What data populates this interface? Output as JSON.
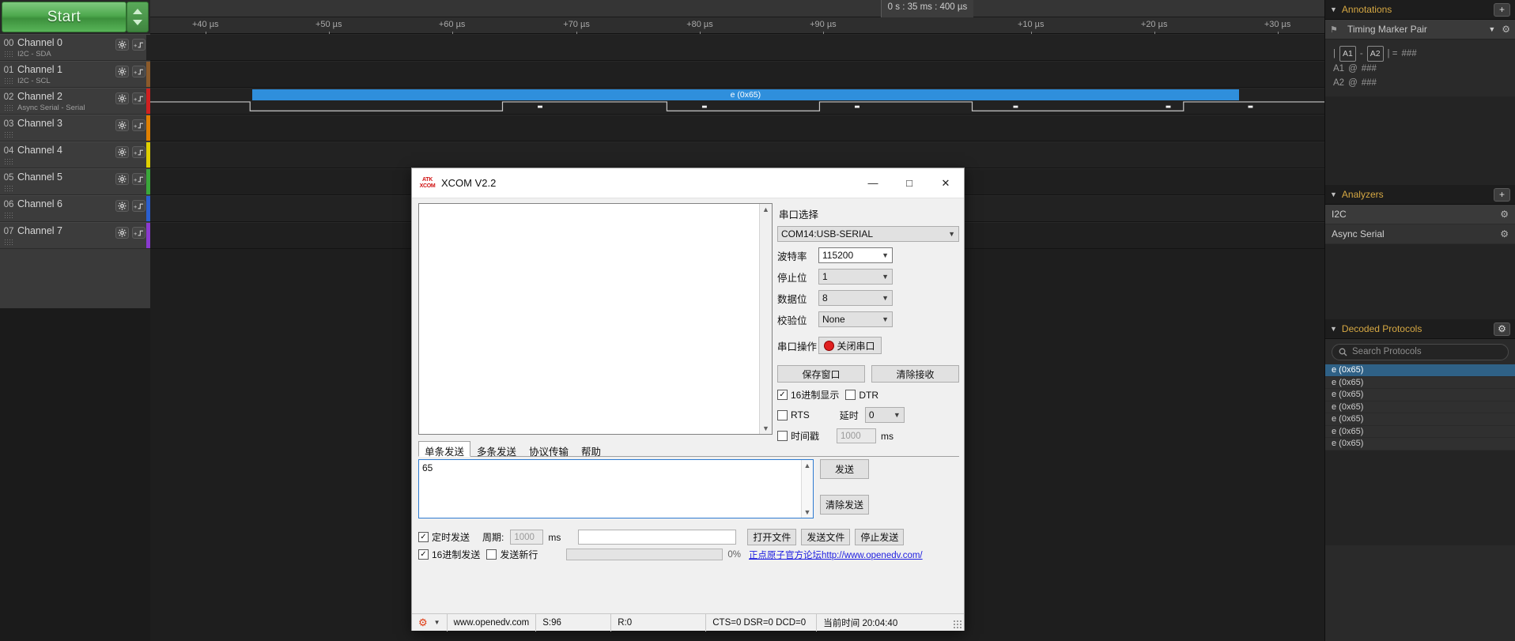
{
  "logic": {
    "start_button": "Start",
    "channels": [
      {
        "index": "00",
        "name": "Channel 0",
        "sub": "I2C - SDA",
        "color": "#222222"
      },
      {
        "index": "01",
        "name": "Channel 1",
        "sub": "I2C - SCL",
        "color": "#8a5a2b"
      },
      {
        "index": "02",
        "name": "Channel 2",
        "sub": "Async Serial - Serial",
        "color": "#d02020"
      },
      {
        "index": "03",
        "name": "Channel 3",
        "sub": "",
        "color": "#e08000"
      },
      {
        "index": "04",
        "name": "Channel 4",
        "sub": "",
        "color": "#e0d000"
      },
      {
        "index": "05",
        "name": "Channel 5",
        "sub": "",
        "color": "#3aa83a"
      },
      {
        "index": "06",
        "name": "Channel 6",
        "sub": "",
        "color": "#2a5fd0"
      },
      {
        "index": "07",
        "name": "Channel 7",
        "sub": "",
        "color": "#8a3ad0"
      }
    ],
    "timeline": {
      "position_chip": "0 s : 35 ms : 400 µs",
      "ticks": [
        {
          "label": "+40 µs",
          "pct": 4.7
        },
        {
          "label": "+50 µs",
          "pct": 15.2
        },
        {
          "label": "+60 µs",
          "pct": 25.7
        },
        {
          "label": "+70 µs",
          "pct": 36.3
        },
        {
          "label": "+80 µs",
          "pct": 46.8
        },
        {
          "label": "+90 µs",
          "pct": 57.3
        },
        {
          "label": "+10 µs",
          "pct": 75.0
        },
        {
          "label": "+20 µs",
          "pct": 85.5
        },
        {
          "label": "+30 µs",
          "pct": 96.0
        }
      ]
    },
    "decoded_bar": {
      "label": "e (0x65)",
      "left_pct": 8.7,
      "width_pct": 84.0
    }
  },
  "sidebar": {
    "annotations": {
      "title": "Annotations",
      "add_label": "+",
      "marker_pair_label": "Timing Marker Pair",
      "rows": [
        {
          "prefix": "|",
          "a": "A1",
          "dash": "-",
          "b": "A2",
          "suffix": "| =",
          "value": "###"
        }
      ],
      "a1_line": {
        "name": "A1",
        "at": "@",
        "value": "###"
      },
      "a2_line": {
        "name": "A2",
        "at": "@",
        "value": "###"
      }
    },
    "analyzers": {
      "title": "Analyzers",
      "add_label": "+",
      "items": [
        {
          "name": "I2C"
        },
        {
          "name": "Async Serial"
        }
      ]
    },
    "decoded_protocols": {
      "title": "Decoded Protocols",
      "search_placeholder": "Search Protocols",
      "items": [
        {
          "text": "e (0x65)",
          "selected": true
        },
        {
          "text": "e (0x65)",
          "selected": false
        },
        {
          "text": "e (0x65)",
          "selected": false
        },
        {
          "text": "e (0x65)",
          "selected": false
        },
        {
          "text": "e (0x65)",
          "selected": false
        },
        {
          "text": "e (0x65)",
          "selected": false
        },
        {
          "text": "e (0x65)",
          "selected": false
        }
      ]
    }
  },
  "xcom": {
    "title": "XCOM V2.2",
    "logo_line1": "ATK",
    "logo_line2": "XCOM",
    "window_buttons": {
      "minimize": "—",
      "maximize": "□",
      "close": "✕"
    },
    "receive_text": "",
    "settings": {
      "port_section_title": "串口选择",
      "port_value": "COM14:USB-SERIAL",
      "baud_label": "波特率",
      "baud_value": "115200",
      "stopbits_label": "停止位",
      "stopbits_value": "1",
      "databits_label": "数据位",
      "databits_value": "8",
      "parity_label": "校验位",
      "parity_value": "None",
      "operation_label": "串口操作",
      "operation_button": "关闭串口",
      "save_window_button": "保存窗口",
      "clear_receive_button": "清除接收",
      "hex_display_label": "16进制显示",
      "hex_display_checked": true,
      "dtr_label": "DTR",
      "dtr_checked": false,
      "rts_label": "RTS",
      "rts_checked": false,
      "delay_label": "延时",
      "delay_value": "0",
      "timestamp_label": "时间戳",
      "timestamp_checked": false,
      "timestamp_value": "1000",
      "timestamp_unit": "ms"
    },
    "tabs": [
      {
        "label": "单条发送",
        "active": true
      },
      {
        "label": "多条发送",
        "active": false
      },
      {
        "label": "协议传输",
        "active": false
      },
      {
        "label": "帮助",
        "active": false
      }
    ],
    "send_input_value": "65",
    "send_button": "发送",
    "clear_send_button": "清除发送",
    "controls": {
      "timed_send_label": "定时发送",
      "timed_send_checked": true,
      "period_label": "周期:",
      "period_value": "1000",
      "period_unit": "ms",
      "file_path_value": "",
      "open_file_button": "打开文件",
      "send_file_button": "发送文件",
      "stop_send_button": "停止发送",
      "hex_send_label": "16进制发送",
      "hex_send_checked": true,
      "newline_label": "发送新行",
      "newline_checked": false,
      "progress_percent": "0%",
      "link_cn": "正点原子官方论坛",
      "link_url": "http://www.openedv.com/"
    },
    "statusbar": {
      "site": "www.openedv.com",
      "sent": "S:96",
      "received": "R:0",
      "signals": "CTS=0 DSR=0 DCD=0",
      "time_label": "当前时间 20:04:40"
    }
  }
}
